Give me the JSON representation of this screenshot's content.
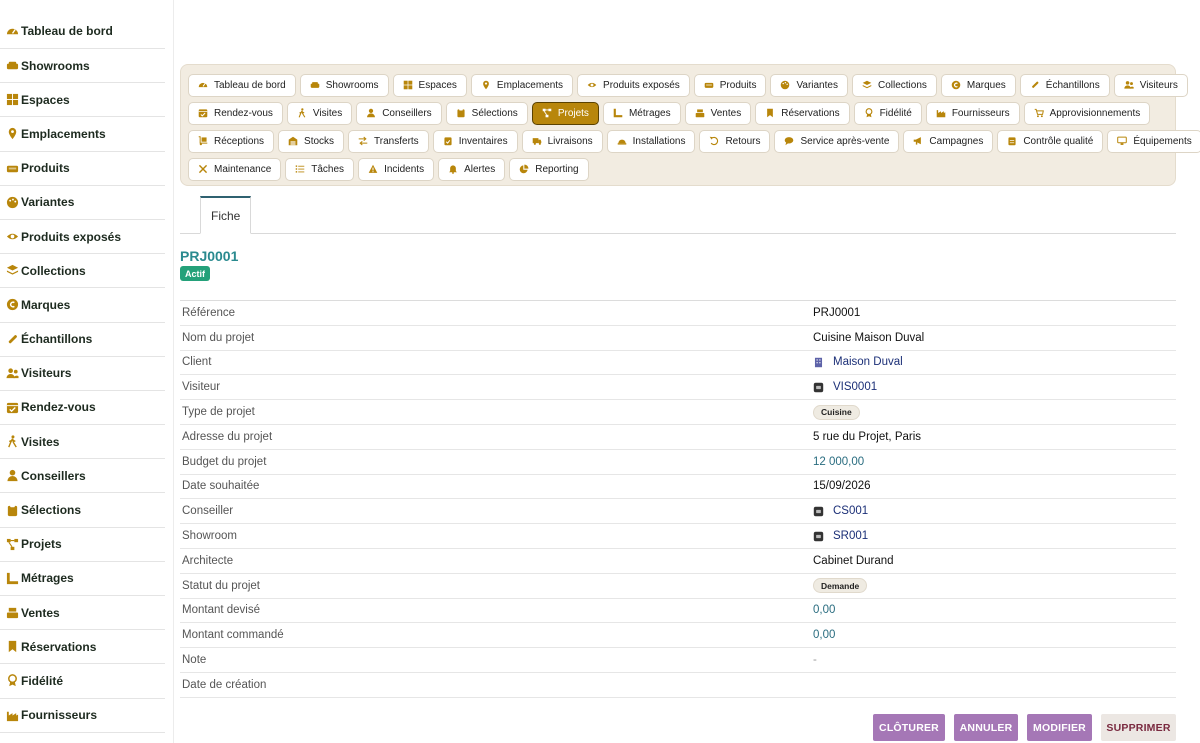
{
  "sidebar": {
    "items": [
      {
        "label": "Tableau de bord",
        "icon": "gauge-icon"
      },
      {
        "label": "Showrooms",
        "icon": "sofa-icon"
      },
      {
        "label": "Espaces",
        "icon": "grid-icon"
      },
      {
        "label": "Emplacements",
        "icon": "map-pin-icon"
      },
      {
        "label": "Produits",
        "icon": "couch-icon"
      },
      {
        "label": "Variantes",
        "icon": "palette-icon"
      },
      {
        "label": "Produits exposés",
        "icon": "eye-icon"
      },
      {
        "label": "Collections",
        "icon": "layers-icon"
      },
      {
        "label": "Marques",
        "icon": "copyright-icon"
      },
      {
        "label": "Échantillons",
        "icon": "eyedropper-icon"
      },
      {
        "label": "Visiteurs",
        "icon": "users-icon"
      },
      {
        "label": "Rendez-vous",
        "icon": "calendar-check-icon"
      },
      {
        "label": "Visites",
        "icon": "walking-icon"
      },
      {
        "label": "Conseillers",
        "icon": "user-tie-icon"
      },
      {
        "label": "Sélections",
        "icon": "clipboard-icon"
      },
      {
        "label": "Projets",
        "icon": "project-diagram-icon"
      },
      {
        "label": "Métrages",
        "icon": "ruler-icon"
      },
      {
        "label": "Ventes",
        "icon": "cash-register-icon"
      },
      {
        "label": "Réservations",
        "icon": "bookmark-icon"
      },
      {
        "label": "Fidélité",
        "icon": "award-icon"
      },
      {
        "label": "Fournisseurs",
        "icon": "industry-icon"
      }
    ]
  },
  "tabs": {
    "rows": [
      [
        {
          "label": "Tableau de bord",
          "icon": "gauge-icon"
        },
        {
          "label": "Showrooms",
          "icon": "sofa-icon"
        },
        {
          "label": "Espaces",
          "icon": "grid-icon"
        },
        {
          "label": "Emplacements",
          "icon": "map-pin-icon"
        },
        {
          "label": "Produits exposés",
          "icon": "eye-icon"
        },
        {
          "label": "Produits",
          "icon": "couch-icon"
        },
        {
          "label": "Variantes",
          "icon": "palette-icon"
        },
        {
          "label": "Collections",
          "icon": "layers-icon"
        },
        {
          "label": "Marques",
          "icon": "copyright-icon"
        },
        {
          "label": "Échantillons",
          "icon": "eyedropper-icon"
        },
        {
          "label": "Visiteurs",
          "icon": "users-icon"
        }
      ],
      [
        {
          "label": "Rendez-vous",
          "icon": "calendar-check-icon"
        },
        {
          "label": "Visites",
          "icon": "walking-icon"
        },
        {
          "label": "Conseillers",
          "icon": "user-tie-icon"
        },
        {
          "label": "Sélections",
          "icon": "clipboard-icon"
        },
        {
          "label": "Projets",
          "icon": "project-diagram-icon",
          "active": true
        },
        {
          "label": "Métrages",
          "icon": "ruler-icon"
        },
        {
          "label": "Ventes",
          "icon": "cash-register-icon"
        },
        {
          "label": "Réservations",
          "icon": "bookmark-icon"
        },
        {
          "label": "Fidélité",
          "icon": "award-icon"
        },
        {
          "label": "Fournisseurs",
          "icon": "industry-icon"
        },
        {
          "label": "Approvisionnements",
          "icon": "cart-arrow-icon"
        }
      ],
      [
        {
          "label": "Réceptions",
          "icon": "dolly-icon"
        },
        {
          "label": "Stocks",
          "icon": "warehouse-icon"
        },
        {
          "label": "Transferts",
          "icon": "exchange-icon"
        },
        {
          "label": "Inventaires",
          "icon": "clipboard-check-icon"
        },
        {
          "label": "Livraisons",
          "icon": "truck-icon"
        },
        {
          "label": "Installations",
          "icon": "hard-hat-icon"
        },
        {
          "label": "Retours",
          "icon": "undo-icon"
        },
        {
          "label": "Service après-vente",
          "icon": "comment-icon"
        },
        {
          "label": "Campagnes",
          "icon": "bullhorn-icon"
        },
        {
          "label": "Contrôle qualité",
          "icon": "clipboard-list-icon"
        },
        {
          "label": "Équipements",
          "icon": "desktop-icon"
        }
      ],
      [
        {
          "label": "Maintenance",
          "icon": "tools-icon"
        },
        {
          "label": "Tâches",
          "icon": "list-icon"
        },
        {
          "label": "Incidents",
          "icon": "warning-icon"
        },
        {
          "label": "Alertes",
          "icon": "bell-icon"
        },
        {
          "label": "Reporting",
          "icon": "chart-pie-icon"
        }
      ]
    ]
  },
  "subtab": {
    "label": "Fiche"
  },
  "record": {
    "title": "PRJ0001",
    "status": "Actif",
    "fields": [
      {
        "label": "Référence",
        "value": "PRJ0001",
        "kind": "text"
      },
      {
        "label": "Nom du projet",
        "value": "Cuisine Maison Duval",
        "kind": "text"
      },
      {
        "label": "Client",
        "value": "Maison Duval",
        "kind": "link",
        "icon": "building-icon"
      },
      {
        "label": "Visiteur",
        "value": "VIS0001",
        "kind": "link",
        "icon": "record-badge-icon"
      },
      {
        "label": "Type de projet",
        "value": "Cuisine",
        "kind": "chip"
      },
      {
        "label": "Adresse du projet",
        "value": "5 rue du Projet, Paris",
        "kind": "text"
      },
      {
        "label": "Budget du projet",
        "value": "12 000,00",
        "kind": "num"
      },
      {
        "label": "Date souhaitée",
        "value": "15/09/2026",
        "kind": "text"
      },
      {
        "label": "Conseiller",
        "value": "CS001",
        "kind": "link",
        "icon": "record-badge-icon"
      },
      {
        "label": "Showroom",
        "value": "SR001",
        "kind": "link",
        "icon": "record-badge-icon"
      },
      {
        "label": "Architecte",
        "value": "Cabinet Durand",
        "kind": "text"
      },
      {
        "label": "Statut du projet",
        "value": "Demande",
        "kind": "chip"
      },
      {
        "label": "Montant devisé",
        "value": "0,00",
        "kind": "num"
      },
      {
        "label": "Montant commandé",
        "value": "0,00",
        "kind": "num"
      },
      {
        "label": "Note",
        "value": "-",
        "kind": "muted"
      },
      {
        "label": "Date de création",
        "value": "",
        "kind": "text"
      }
    ]
  },
  "actions": {
    "close_label": "CLÔTURER",
    "cancel_label": "ANNULER",
    "edit_label": "MODIFIER",
    "delete_label": "SUPPRIMER"
  },
  "colors": {
    "accent_gold": "#b8860b",
    "active_tab_border": "#5b4200",
    "title_teal": "#2a8a8f",
    "status_green": "#24a17a",
    "action_purple": "#a577b6",
    "link_navy": "#1b2f77"
  }
}
